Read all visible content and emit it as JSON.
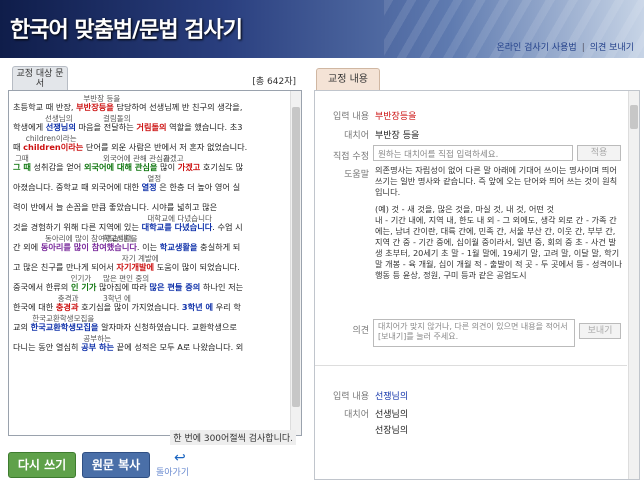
{
  "header": {
    "app_title": "한국어 맞춤법/문법 검사기",
    "link_usage": "온라인 검사기 사용법",
    "link_sep": "|",
    "link_feedback": "의견 보내기"
  },
  "left": {
    "tab_label": "교정 대상 문서",
    "char_count": "[총 642자]",
    "limit_note": "한 번에 300어절씩 검사합니다.",
    "lines": [
      {
        "ann": "부반장 등을",
        "text_pre": "초등학교 때 반장, ",
        "hl": "부반장등을",
        "hl_class": "red",
        "text_post": " 담당하여 선생님께 반 친구의 생각을,"
      },
      {
        "ann": "선생님의",
        "ann2": "걸림돌의",
        "text_pre": "학생에게 ",
        "hl": "선쟁님의",
        "hl_class": "blue",
        "text_mid": " 마음을 전달하는 ",
        "hl2": "거림돌의",
        "hl2_class": "red",
        "text_post": " 역할을 했습니다. 초3"
      },
      {
        "ann": "children이라는",
        "text_pre": "때 ",
        "hl": "children이라는",
        "hl_class": "red",
        "text_post": " 단어를 외운 사람은 반에서 저 혼자 없었습니다."
      },
      {
        "ann": "그때",
        "ann2": "외국어에 관해 관심을",
        "ann3": "가겠고",
        "text_pre": "",
        "hl": "그 때",
        "hl_class": "green",
        "text_mid": " 성취감을 얻어 ",
        "hl2": "외국어에 대해 관심을",
        "hl2_class": "green",
        "text_mid2": " 많이 ",
        "hl3": "가겠고",
        "hl3_class": "red",
        "text_post": " 호기심도 많"
      },
      {
        "ann": "열정",
        "text_pre": "아졌습니다. 중학교 때 외국어에 대한 ",
        "hl": "열정",
        "hl_class": "blue",
        "text_post": " 은 한층 더 높아 영어 실"
      },
      {
        "ann": "",
        "text_pre": "력이 반에서 늘 손꼽을 만큼 좋았습니다. 시야를 넓히고 많은",
        "hl": "",
        "hl_class": "",
        "text_post": ""
      },
      {
        "ann": "대학교에 다녔습니다",
        "text_pre": "것을 경험하기 위해 다른 지역에 있는 ",
        "hl": "대학교를 다녔습니다",
        "hl_class": "blue",
        "text_post": ". 수업 시"
      },
      {
        "ann": "동아리에 많이 참여했습니다",
        "ann2": "학교생활을",
        "text_pre": "간 외에 ",
        "hl": "동아리를 많이 참여했습니다",
        "hl_class": "purple",
        "text_mid": ". 이는 ",
        "hl2": "학교생활을",
        "hl2_class": "blue",
        "text_post": " 충실하게 되"
      },
      {
        "ann": "자기 계발에",
        "text_pre": "고 많은 친구를 만나게 되어서 ",
        "hl": "자기개발에",
        "hl_class": "red",
        "text_post": " 도움이 많이 되었습니다."
      },
      {
        "ann": "인기가",
        "ann2": "많은 편인 중의",
        "text_pre": "중국에서 한류의 ",
        "hl": "인 기가",
        "hl_class": "green",
        "text_mid": " 많아짐에 따라 ",
        "hl2": "많은 편들 중의",
        "hl2_class": "blue",
        "text_post": " 하나인 저는"
      },
      {
        "ann": "충격과",
        "ann2": "3학년 에",
        "text_pre": "한국에 대한 ",
        "hl": "충경과",
        "hl_class": "red",
        "text_mid": " 호기심을 많이 가지었습니다. ",
        "hl2": "3학년 에",
        "hl2_class": "blue",
        "text_post": " 우리 학"
      },
      {
        "ann": "한국교환학생모집을",
        "text_pre": "교의 ",
        "hl": "한국교환학생모집을",
        "hl_class": "blue",
        "text_post": " 알자마자 신청하였습니다. 교환학생으로"
      },
      {
        "ann": "공부하는",
        "text_pre": "다니는 동안 열심히 ",
        "hl": "공부 하는",
        "hl_class": "blue",
        "text_post": " 끝에 성적은 모두 A로 나왔습니다. 외"
      }
    ]
  },
  "buttons": {
    "retry": "다시 쓰기",
    "copy": "원문 복사",
    "back": "돌아가기"
  },
  "right": {
    "tab_label": "교정 내용",
    "entry1": {
      "input_label": "입력 내용",
      "input_value": "부반장등을",
      "suggest_label": "대치어",
      "suggest_value": "부반장 등을",
      "manual_label": "직접 수정",
      "manual_placeholder": "원하는 대치어를 직접 입력하세요.",
      "apply_button": "적용",
      "help_label": "도움말",
      "help_text_1": "의존명사는 자립성이 없어 다른 말 아래에 기대어 쓰이는 명사이며 띄어쓰기는 일반 명사와 같습니다. 즉 앞에 오는 단어와 띄어 쓰는 것이 원칙입니다.",
      "help_text_2": "(예) 것 - 새 것을, 많은 것을, 마실 것, 내 것, 어떤 것",
      "help_text_3": "내 - 기간 내에, 지역 내, 한도 내 외 - 그 외에도, 생각 외로 간 - 가족 간에는, 남녀 간이란, 대륙 간에, 민족 간, 서울 부산 간, 이웃 간, 부부 간, 지역 간 중 - 기간 중에, 십이월 중이라서, 일년 중, 회의 중 초 - 사건 발생 초부터, 20세기 초 말 - 1월 말에, 19세기 말, 고려 말, 이달 말, 학기 말 개봉 - 육 개월, 십이 개월 적 - 출발이 적 곳 - 두 곳에서 등 - 성격이나 행동 등 윤상, 정원, 구미 등과 같은 공업도시",
      "opinion_label": "의견",
      "opinion_placeholder": "대치어가 맞지 않거나, 다른 의견이 있으면 내용을 적어서 [보내기]를 눌러 주세요.",
      "send_button": "보내기"
    },
    "entry2": {
      "input_label": "입력 내용",
      "input_value": "선쟁님의",
      "suggest_label": "대치어",
      "suggest_value_1": "선생님의",
      "suggest_value_2": "선장님의"
    }
  }
}
